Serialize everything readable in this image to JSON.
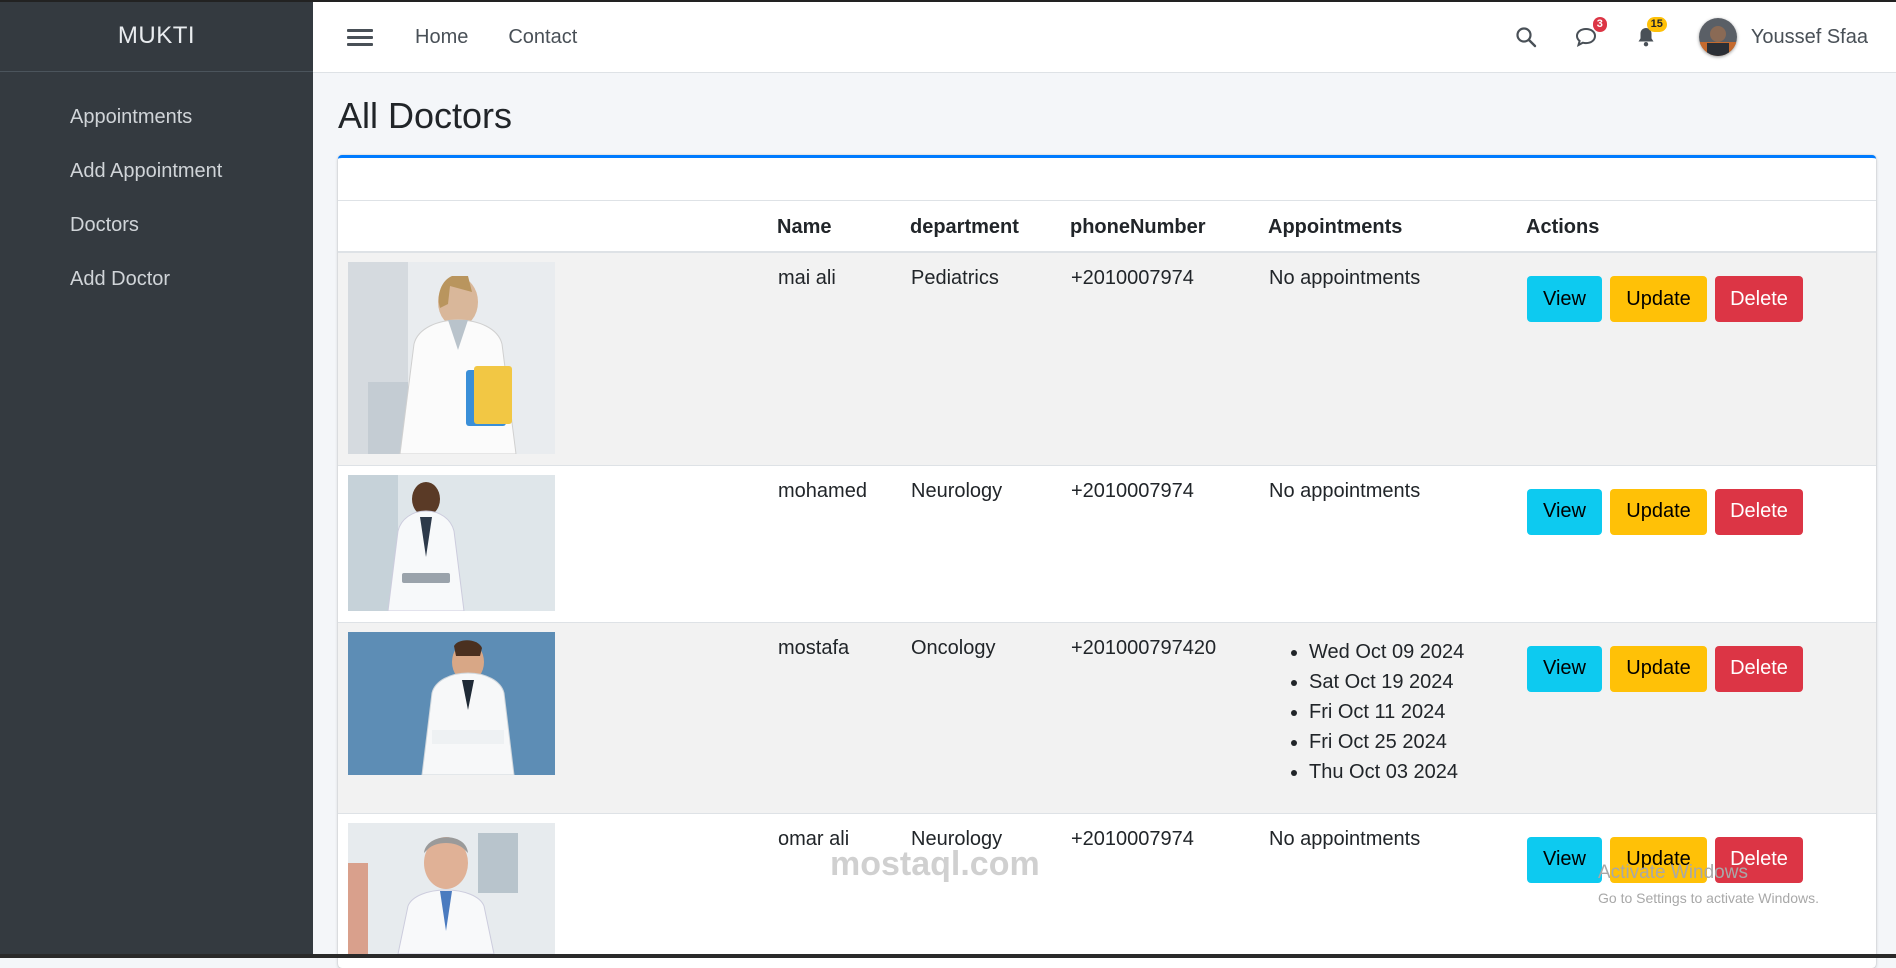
{
  "sidebar": {
    "brand": "MUKTI",
    "items": [
      {
        "label": "Appointments"
      },
      {
        "label": "Add Appointment"
      },
      {
        "label": "Doctors"
      },
      {
        "label": "Add Doctor"
      }
    ]
  },
  "header": {
    "links": [
      {
        "label": "Home"
      },
      {
        "label": "Contact"
      }
    ],
    "messages_badge": "3",
    "notifications_badge": "15",
    "user_name": "Youssef Sfaa"
  },
  "page": {
    "title": "All Doctors"
  },
  "table": {
    "headers": [
      "",
      "Name",
      "department",
      "phoneNumber",
      "Appointments",
      "Actions"
    ],
    "rows": [
      {
        "name": "mai ali",
        "department": "Pediatrics",
        "phone": "+2010007974",
        "appointments_text": "No appointments"
      },
      {
        "name": "mohamed",
        "department": "Neurology",
        "phone": "+2010007974",
        "appointments_text": "No appointments"
      },
      {
        "name": "mostafa",
        "department": "Oncology",
        "phone": "+201000797420",
        "appointments": [
          "Wed Oct 09 2024",
          "Sat Oct 19 2024",
          "Fri Oct 11 2024",
          "Fri Oct 25 2024",
          "Thu Oct 03 2024"
        ]
      },
      {
        "name": "omar ali",
        "department": "Neurology",
        "phone": "+2010007974",
        "appointments_text": "No appointments"
      }
    ],
    "actions": {
      "view": "View",
      "update": "Update",
      "delete": "Delete"
    }
  },
  "overlays": {
    "watermark": "mostaql.com",
    "activate_title": "Activate Windows",
    "activate_sub": "Go to Settings to activate Windows."
  },
  "colors": {
    "sidebar_bg": "#343a40",
    "card_accent": "#007bff",
    "view_btn": "#0dcaf0",
    "update_btn": "#ffc107",
    "delete_btn": "#dc3545"
  }
}
